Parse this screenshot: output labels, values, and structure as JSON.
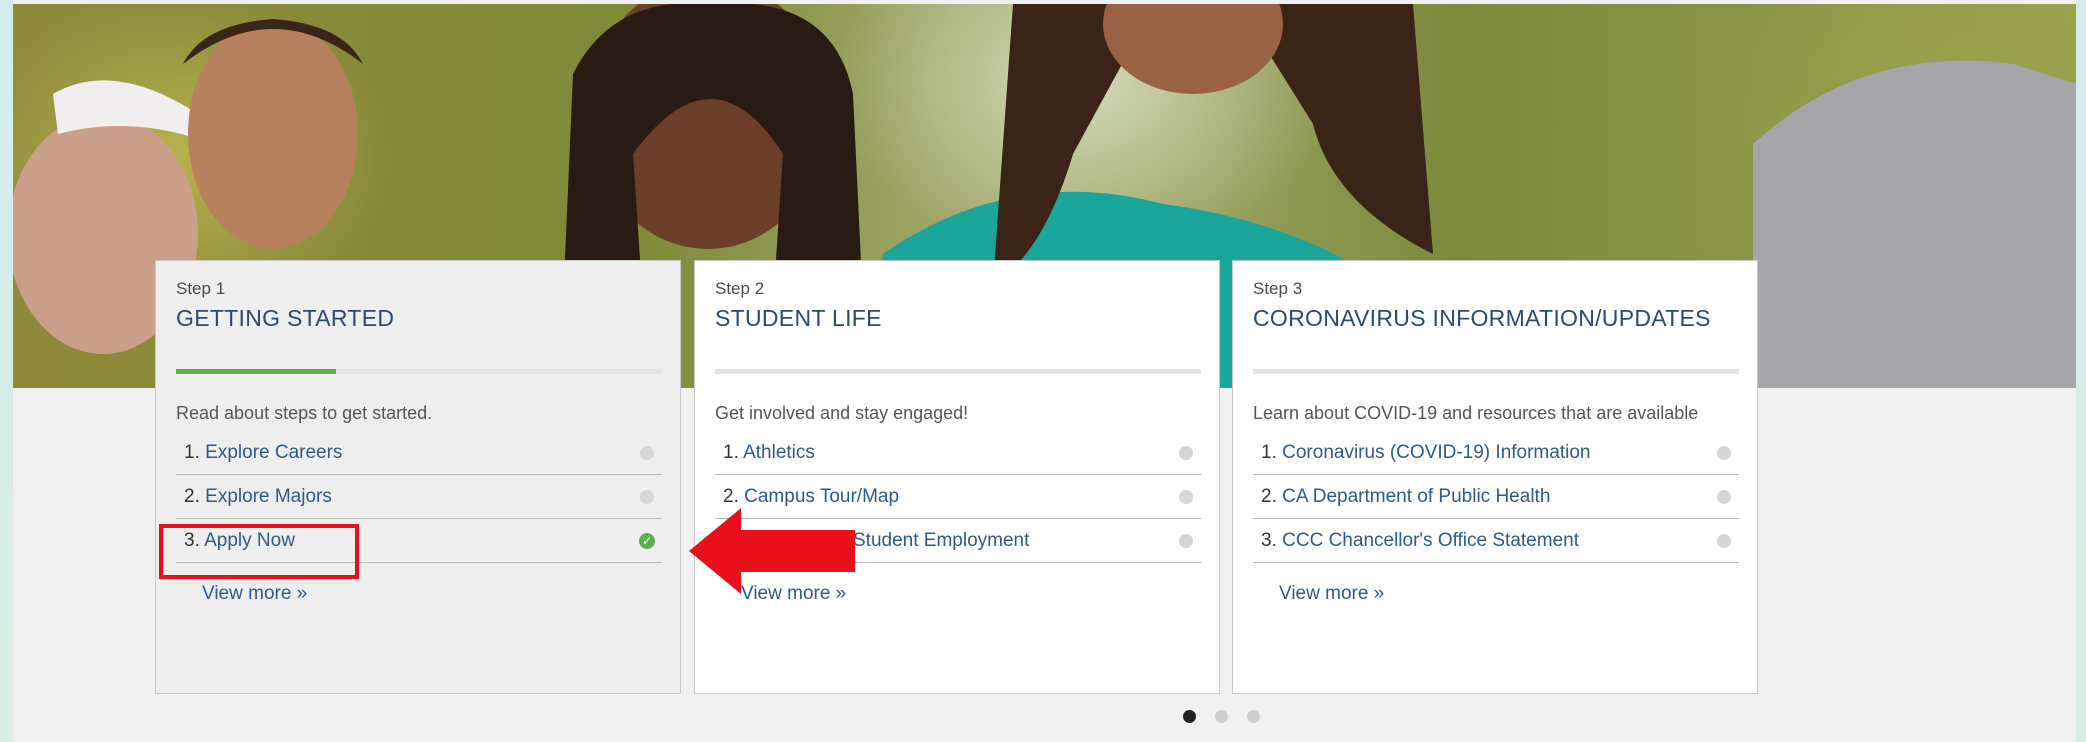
{
  "cards": [
    {
      "step": "Step 1",
      "title": "GETTING STARTED",
      "progress": 0.33,
      "description": "Read about steps to get started.",
      "items": [
        {
          "num": "1.",
          "label": "Explore Careers",
          "status": "incomplete"
        },
        {
          "num": "2.",
          "label": "Explore Majors",
          "status": "incomplete"
        },
        {
          "num": "3.",
          "label": "Apply Now",
          "status": "complete"
        }
      ],
      "view_more": "View more »"
    },
    {
      "step": "Step 2",
      "title": "STUDENT LIFE",
      "progress": 0,
      "description": "Get involved and stay engaged!",
      "items": [
        {
          "num": "1.",
          "label": "Athletics",
          "status": "incomplete"
        },
        {
          "num": "2.",
          "label": "Campus Tour/Map",
          "status": "incomplete"
        },
        {
          "num": "",
          "label": "Student Employment",
          "status": "incomplete"
        }
      ],
      "view_more": "View more »"
    },
    {
      "step": "Step 3",
      "title": "CORONAVIRUS INFORMATION/UPDATES",
      "progress": 0,
      "description": "Learn about COVID-19 and resources that are available",
      "items": [
        {
          "num": "1.",
          "label": "Coronavirus (COVID-19) Information",
          "status": "incomplete"
        },
        {
          "num": "2.",
          "label": "CA Department of Public Health",
          "status": "incomplete"
        },
        {
          "num": "3.",
          "label": "CCC Chancellor's Office Statement",
          "status": "incomplete"
        }
      ],
      "view_more": "View more »"
    }
  ],
  "carousel": {
    "pages": 3,
    "active_index": 0
  },
  "colors": {
    "title": "#2b4a70",
    "link": "#2e5a8a",
    "progress": "#5cb04b",
    "annotation": "#e8101a"
  },
  "icons": {
    "complete": "check-circle-icon",
    "incomplete": "dot-icon",
    "annotation": "red-arrow-icon"
  }
}
